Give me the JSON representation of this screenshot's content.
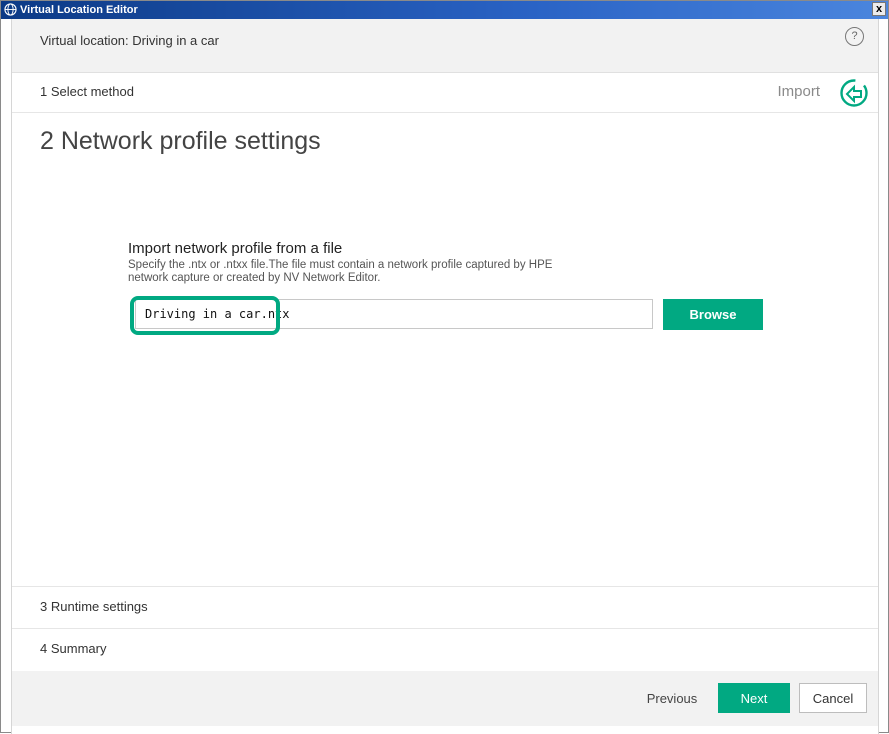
{
  "window": {
    "title": "Virtual Location Editor",
    "close_label": "x"
  },
  "header": {
    "location_title": "Virtual location: Driving in a car",
    "help_label": "?"
  },
  "steps": {
    "step1": {
      "label": "1  Select method",
      "method": "Import"
    },
    "step2": {
      "label": "2  Network profile settings"
    },
    "step3": {
      "label": "3  Runtime settings"
    },
    "step4": {
      "label": "4  Summary"
    }
  },
  "import": {
    "heading": "Import network profile from a file",
    "description": "Specify the .ntx or .ntxx file.The file must contain a network profile captured by HPE network capture or created by NV Network Editor.",
    "file_value": "Driving in a car.ntx",
    "browse_label": "Browse"
  },
  "footer": {
    "previous_label": "Previous",
    "next_label": "Next",
    "cancel_label": "Cancel"
  },
  "colors": {
    "accent": "#01a982",
    "titlebar": "#1f4fa8",
    "header_bg": "#f2f2f2"
  },
  "icons": {
    "app": "globe-icon",
    "help": "help-circle-icon",
    "import": "import-icon",
    "close": "close-icon"
  }
}
